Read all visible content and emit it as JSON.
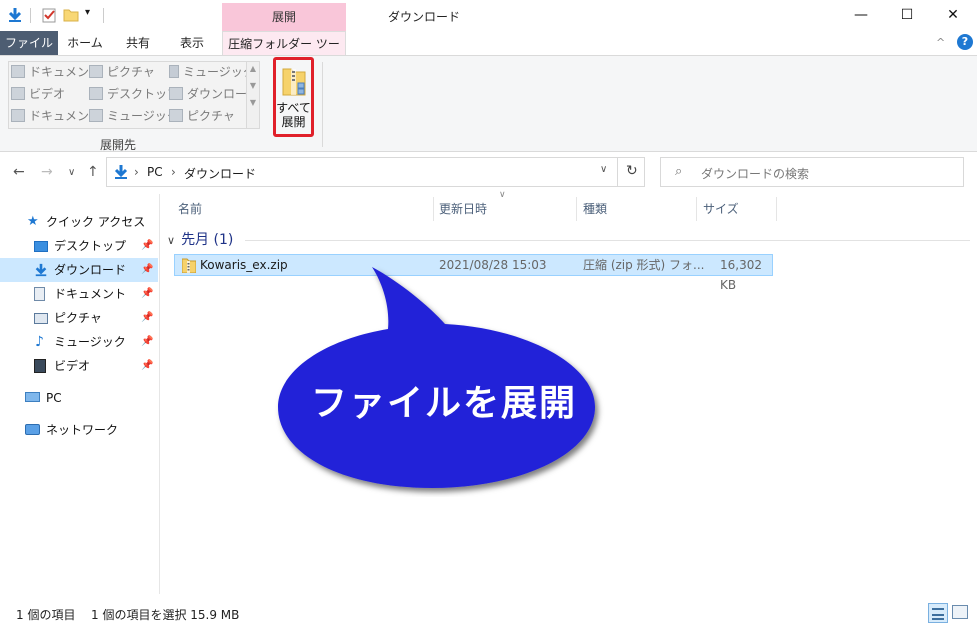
{
  "window": {
    "title": "ダウンロード",
    "context_tab_header": "展開",
    "minimize": "—",
    "maximize": "☐",
    "close": "✕"
  },
  "ribbon_tabs": {
    "file": "ファイル",
    "home": "ホーム",
    "share": "共有",
    "view": "表示",
    "compressed_tools": "圧縮フォルダー ツール"
  },
  "ribbon": {
    "gallery": [
      {
        "label": "ドキュメント",
        "icon": "document-icon"
      },
      {
        "label": "ピクチャ",
        "icon": "picture-icon"
      },
      {
        "label": "ミュージック",
        "icon": "music-icon"
      },
      {
        "label": "ビデオ",
        "icon": "video-icon"
      },
      {
        "label": "デスクトップ",
        "icon": "desktop-icon"
      },
      {
        "label": "ダウンロード",
        "icon": "download-icon"
      },
      {
        "label": "ドキュメント",
        "icon": "document-icon"
      },
      {
        "label": "ミュージック",
        "icon": "music-icon"
      },
      {
        "label": "ピクチャ",
        "icon": "picture-icon"
      }
    ],
    "group_label": "展開先",
    "extract_all_line1": "すべて",
    "extract_all_line2": "展開"
  },
  "address": {
    "crumbs": [
      "PC",
      "ダウンロード"
    ],
    "search_placeholder": "ダウンロードの検索"
  },
  "nav_pane": {
    "quick_access": "クイック アクセス",
    "items": [
      {
        "label": "デスクトップ",
        "icon": "desktop-icon"
      },
      {
        "label": "ダウンロード",
        "icon": "download-icon"
      },
      {
        "label": "ドキュメント",
        "icon": "document-icon"
      },
      {
        "label": "ピクチャ",
        "icon": "picture-icon"
      },
      {
        "label": "ミュージック",
        "icon": "music-icon"
      },
      {
        "label": "ビデオ",
        "icon": "video-icon"
      }
    ],
    "pc": "PC",
    "network": "ネットワーク"
  },
  "columns": {
    "name": "名前",
    "date": "更新日時",
    "type": "種類",
    "size": "サイズ"
  },
  "group": {
    "label": "先月 (1)"
  },
  "file": {
    "name": "Kowaris_ex.zip",
    "date": "2021/08/28 15:03",
    "type": "圧縮 (zip 形式) フォ...",
    "size": "16,302 KB"
  },
  "callout": {
    "text": "ファイルを展開"
  },
  "status": {
    "count": "1 個の項目",
    "selection": "1 個の項目を選択  15.9 MB"
  },
  "colors": {
    "accent": "#0078d7",
    "file_tab": "#4d5d72",
    "context_tab": "#f9c6d9",
    "selection": "#cce8ff",
    "callout": "#2323d8",
    "highlight_box": "#e0202a"
  }
}
